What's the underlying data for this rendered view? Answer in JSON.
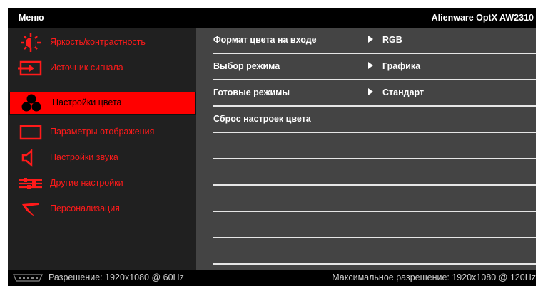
{
  "header": {
    "title": "Меню",
    "model": "Alienware OptX AW2310"
  },
  "sidebar": {
    "items": [
      {
        "label": "Яркость/контрастность",
        "icon": "sun-brightness-icon"
      },
      {
        "label": "Источник сигнала",
        "icon": "input-source-icon"
      },
      {
        "label": "Настройки цвета",
        "icon": "color-circles-icon",
        "active": true
      },
      {
        "label": "Параметры отображения",
        "icon": "display-rectangle-icon"
      },
      {
        "label": "Настройки звука",
        "icon": "speaker-icon"
      },
      {
        "label": "Другие настройки",
        "icon": "sliders-icon"
      },
      {
        "label": "Персонализация",
        "icon": "personalize-icon"
      }
    ]
  },
  "content": {
    "rows": [
      {
        "label": "Формат цвета на входе",
        "value": "RGB"
      },
      {
        "label": "Выбор режима",
        "value": "Графика"
      },
      {
        "label": "Готовые режимы",
        "value": "Стандарт"
      },
      {
        "label": "Сброс настроек цвета",
        "value": ""
      },
      {
        "label": "",
        "value": ""
      },
      {
        "label": "",
        "value": ""
      },
      {
        "label": "",
        "value": ""
      },
      {
        "label": "",
        "value": ""
      }
    ]
  },
  "status": {
    "resolution": "Разрешение: 1920x1080 @ 60Hz",
    "max_resolution": "Максимальное разрешение: 1920x1080 @ 120Hz"
  },
  "colors": {
    "accent": "#ff0000",
    "sidebar_bg": "#202020",
    "content_bg": "#444444",
    "divider": "#e6e6e6"
  }
}
